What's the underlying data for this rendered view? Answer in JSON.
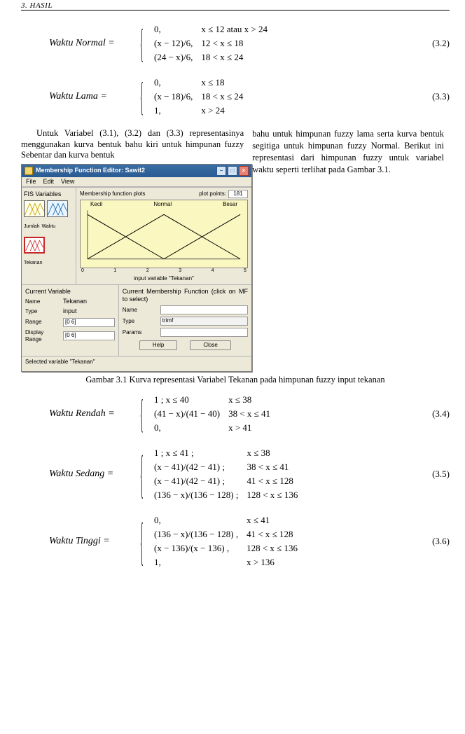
{
  "running_head": "3. HASIL",
  "eq_normal": {
    "label": "Waktu Normal =",
    "rows": [
      [
        "0,",
        "x ≤ 12 atau x > 24"
      ],
      [
        "(x − 12)/6,",
        "12 < x ≤ 18"
      ],
      [
        "(24 − x)/6,",
        "18 < x ≤ 24"
      ]
    ],
    "num": "(3.2)"
  },
  "eq_lama": {
    "label": "Waktu Lama    =",
    "rows": [
      [
        "0,",
        "x ≤ 18"
      ],
      [
        "(x − 18)/6,",
        "18 < x ≤ 24"
      ],
      [
        "1,",
        "x > 24"
      ]
    ],
    "num": "(3.3)"
  },
  "p_left_1": "Untuk Variabel (3.1), (3.2) dan (3.3) representasinya menggunakan kurva bentuk bahu kiri untuk himpunan fuzzy Sebentar dan kurva bentuk",
  "p_right_1": "bahu untuk himpunan fuzzy lama serta kurva bentuk segitiga untuk himpunan fuzzy Normal. Berikut ini representasi dari himpunan fuzzy untuk variabel waktu seperti terlihat pada Gambar 3.1.",
  "mfe": {
    "title": "Membership Function Editor: Sawit2",
    "menu": [
      "File",
      "Edit",
      "View"
    ],
    "vars_title": "FIS Variables",
    "in_labels": [
      "Jumlah",
      "Waktu"
    ],
    "out_label": "Tekanan",
    "plot_hdr_left": "Membership function plots",
    "plot_points_lbl": "plot points:",
    "plot_points_val": "181",
    "mf_names": [
      "Kecil",
      "Normal",
      "Besar"
    ],
    "xticks": [
      "0",
      "1",
      "2",
      "3",
      "4",
      "5"
    ],
    "xlabel": "input variable \"Tekanan\"",
    "cur": {
      "title": "Current Variable",
      "name_lbl": "Name",
      "name_val": "Tekanan",
      "type_lbl": "Type",
      "type_val": "input",
      "range_lbl": "Range",
      "range_val": "[0 6]",
      "drange_lbl": "Display Range",
      "drange_val": "[0 6]"
    },
    "cmf": {
      "title": "Current Membership Function (click on MF to select)",
      "name_lbl": "Name",
      "name_val": "",
      "type_lbl": "Type",
      "type_val": "trimf",
      "params_lbl": "Params",
      "params_val": ""
    },
    "help_btn": "Help",
    "close_btn": "Close",
    "status": "Selected variable \"Tekanan\""
  },
  "fig_caption": "Gambar 3.1 Kurva representasi Variabel Tekanan pada himpunan fuzzy input tekanan",
  "eq_rendah": {
    "label": "Waktu Rendah  =",
    "rows": [
      [
        "1 ; x ≤ 40",
        "x ≤ 38"
      ],
      [
        "(41 − x)/(41 − 40)",
        "38 < x ≤ 41"
      ],
      [
        "0,",
        "x > 41"
      ]
    ],
    "num": "(3.4)"
  },
  "eq_sedang": {
    "label": "Waktu Sedang  =",
    "rows": [
      [
        "1 ; x ≤ 41 ;",
        "x ≤ 38"
      ],
      [
        "(x − 41)/(42 − 41) ;",
        "38 < x ≤ 41"
      ],
      [
        "(x − 41)/(42 − 41) ;",
        "41 < x ≤ 128"
      ],
      [
        "(136 − x)/(136 − 128) ;",
        "128 < x ≤ 136"
      ]
    ],
    "num": "(3.5)"
  },
  "eq_tinggi": {
    "label": "Waktu Tinggi   =",
    "rows": [
      [
        "0,",
        "x ≤ 41"
      ],
      [
        "(136 − x)/(136 − 128) ,",
        "41 < x ≤ 128"
      ],
      [
        "(x − 136)/(x − 136) ,",
        "128 < x ≤ 136"
      ],
      [
        "1,",
        "x > 136"
      ]
    ],
    "num": "(3.6)"
  },
  "chart_data": {
    "type": "line",
    "title": "Membership function plots — input variable \"Tekanan\"",
    "xlabel": "input variable \"Tekanan\"",
    "ylabel": "",
    "xlim": [
      0,
      5
    ],
    "ylim": [
      0,
      1
    ],
    "xticks": [
      0,
      1,
      2,
      3,
      4,
      5
    ],
    "series": [
      {
        "name": "Kecil",
        "type_mf": "trimf_left_shoulder",
        "x": [
          0,
          0,
          2.5
        ],
        "y": [
          1,
          1,
          0
        ]
      },
      {
        "name": "Normal",
        "type_mf": "trimf",
        "x": [
          0,
          2.5,
          5
        ],
        "y": [
          0,
          1,
          0
        ]
      },
      {
        "name": "Besar",
        "type_mf": "trimf_right_shoulder",
        "x": [
          2.5,
          5,
          5
        ],
        "y": [
          0,
          1,
          1
        ]
      }
    ]
  }
}
